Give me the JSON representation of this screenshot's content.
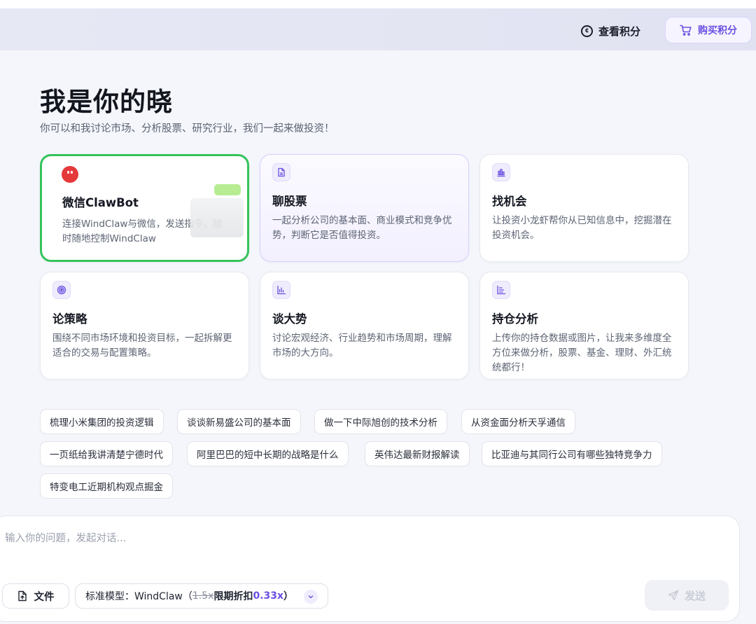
{
  "header": {
    "points_label": "查看积分",
    "buy_label": "购买积分"
  },
  "hero": {
    "title": "我是你的晓",
    "subtitle": "你可以和我讨论市场、分析股票、研究行业，我们一起来做投资！"
  },
  "cards": [
    {
      "title": "微信ClawBot",
      "desc": "连接WindClaw与微信，发送指令，随时随地控制WindClaw",
      "icon": "bot-icon",
      "state": "selected"
    },
    {
      "title": "聊股票",
      "desc": "一起分析公司的基本面、商业模式和竞争优势，判断它是否值得投资。",
      "icon": "document-icon",
      "state": "hovered"
    },
    {
      "title": "找机会",
      "desc": "让投资小龙虾帮你从已知信息中，挖掘潜在投资机会。",
      "icon": "bar-chart-icon",
      "state": "normal"
    },
    {
      "title": "论策略",
      "desc": "围绕不同市场环境和投资目标，一起拆解更适合的交易与配置策略。",
      "icon": "target-icon",
      "state": "normal"
    },
    {
      "title": "谈大势",
      "desc": "讨论宏观经济、行业趋势和市场周期，理解市场的大方向。",
      "icon": "trend-chart-icon",
      "state": "normal"
    },
    {
      "title": "持仓分析",
      "desc": "上传你的持仓数据或图片，让我来多维度全方位来做分析，股票、基金、理财、外汇统统都行！",
      "icon": "portfolio-icon",
      "state": "normal"
    }
  ],
  "suggestions": [
    "梳理小米集团的投资逻辑",
    "谈谈新易盛公司的基本面",
    "做一下中际旭创的技术分析",
    "从资金面分析天孚通信",
    "一页纸给我讲清楚宁德时代",
    "阿里巴巴的短中长期的战略是什么",
    "英伟达最新财报解读",
    "比亚迪与其同行公司有哪些独特竞争力",
    "特变电工近期机构观点掘金"
  ],
  "composer": {
    "placeholder": "输入你的问题，发起对话...",
    "file_label": "文件",
    "model_prefix": "标准模型：WindClaw（",
    "model_old_rate": "1.5x",
    "model_discount": " 限期折扣 ",
    "model_rate": "0.33x",
    "model_suffix": "）",
    "send_label": "发送"
  },
  "colors": {
    "accent": "#6b4fe0",
    "selected_border": "#35c25a",
    "bot_red": "#e5383b"
  }
}
